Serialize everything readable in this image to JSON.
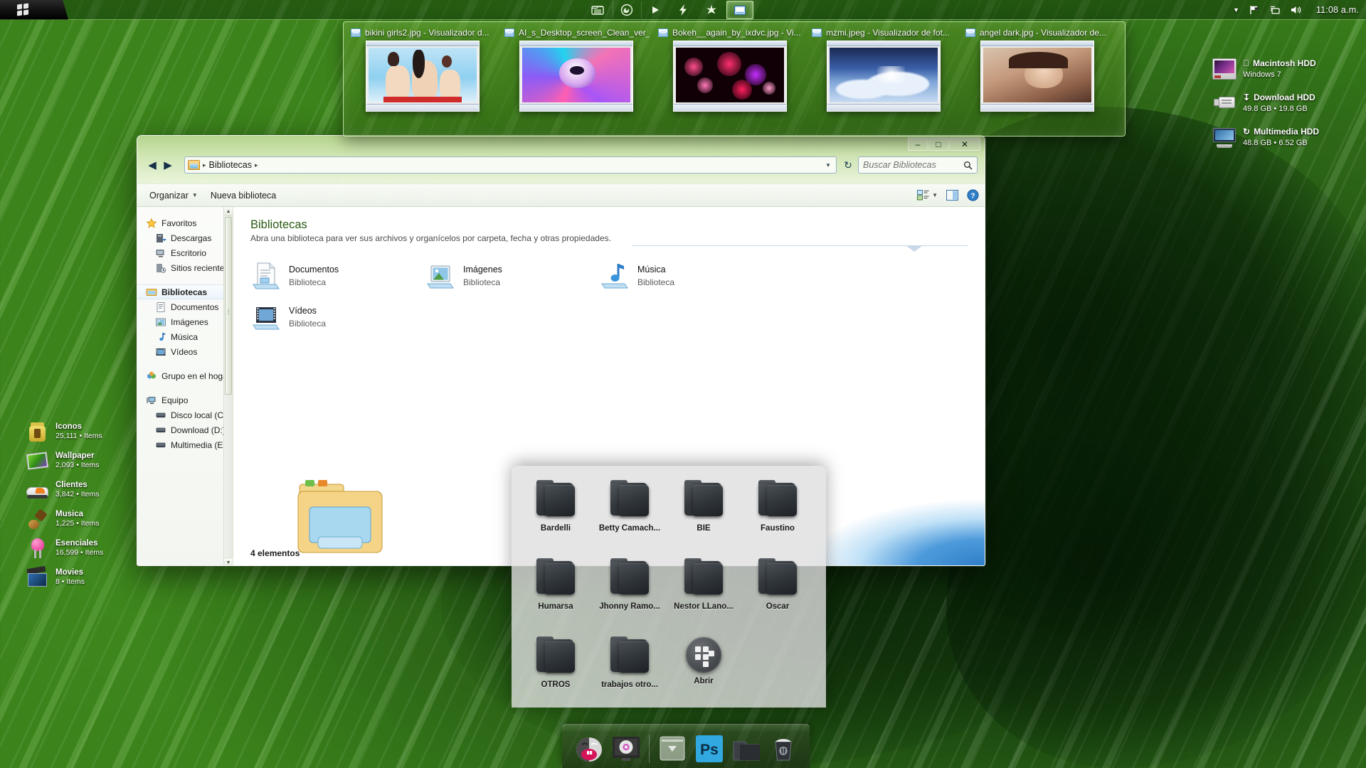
{
  "taskbar": {
    "start_label": "Start",
    "buttons": [
      {
        "name": "explorer-taskbar-button",
        "icon": "folder-icon",
        "active": false
      },
      {
        "name": "firefox-taskbar-button",
        "icon": "firefox-icon",
        "active": false
      },
      {
        "name": "media-player-taskbar-button",
        "icon": "play-icon",
        "active": false
      },
      {
        "name": "lightning-taskbar-button",
        "icon": "lightning-icon",
        "active": false
      },
      {
        "name": "sparkle-taskbar-button",
        "icon": "sparkle-icon",
        "active": false
      },
      {
        "name": "photo-viewer-taskbar-button",
        "icon": "photo-viewer-icon",
        "active": true
      }
    ],
    "tray": {
      "show_hidden_icons": "chevron-up-icon",
      "action_center": "flag-icon",
      "network": "network-icon",
      "volume": "speaker-icon",
      "clock": "11:08 a.m."
    }
  },
  "preview_strip": {
    "items": [
      {
        "title": "bikini girls2.jpg - Visualizador d...",
        "icon": "photo-viewer-icon",
        "art": "bikini"
      },
      {
        "title": "AI_s_Desktop_screen_Clean_ver_...",
        "icon": "photo-viewer-icon",
        "art": "ai"
      },
      {
        "title": "Bokeh__again_by_ixdvc.jpg - Vi...",
        "icon": "photo-viewer-icon",
        "art": "bokeh"
      },
      {
        "title": "mzmi.jpeg - Visualizador de fot...",
        "icon": "photo-viewer-icon",
        "art": "mzmi"
      },
      {
        "title": "angel dark.jpg - Visualizador de...",
        "icon": "photo-viewer-icon",
        "art": "angel"
      }
    ]
  },
  "desktop_left": {
    "items": [
      {
        "name": "Iconos",
        "count": "25,111 • Items",
        "icon": "jar-icon"
      },
      {
        "name": "Wallpaper",
        "count": "2,093 • Items",
        "icon": "picture-icon"
      },
      {
        "name": "Clientes",
        "count": "3,842 • Items",
        "icon": "shoe-icon"
      },
      {
        "name": "Musica",
        "count": "1,225 • Items",
        "icon": "guitar-icon"
      },
      {
        "name": "Esenciales",
        "count": "16,599 • Items",
        "icon": "led-icon"
      },
      {
        "name": "Movies",
        "count": "8 • Items",
        "icon": "clapperboard-icon"
      }
    ]
  },
  "desktop_right": {
    "drives": [
      {
        "glyph": "",
        "name": "Macintosh HDD",
        "sub": "Windows 7",
        "icon": "hard-drive-icon"
      },
      {
        "glyph": "↧",
        "name": "Download HDD",
        "sub": "49.8 GB • 19.8 GB",
        "icon": "usb-drive-icon"
      },
      {
        "glyph": "↻",
        "name": "Multimedia HDD",
        "sub": "48.8 GB • 6.52 GB",
        "icon": "external-drive-icon"
      }
    ]
  },
  "explorer": {
    "window_controls": {
      "minimize": "–",
      "maximize": "□",
      "close": "✕"
    },
    "nav": {
      "back": "◀",
      "forward": "▶"
    },
    "address": {
      "crumb": "Bibliotecas",
      "separator": "▸",
      "dropdown": "▾",
      "refresh": "↻"
    },
    "search": {
      "placeholder": "Buscar Bibliotecas",
      "value": "",
      "icon": "search-icon"
    },
    "toolbar": {
      "organize": "Organizar",
      "new_library": "Nueva biblioteca",
      "view_icon": "view-options-icon",
      "preview_pane_icon": "preview-pane-icon",
      "help_icon": "help-icon"
    },
    "sidebar": [
      {
        "label": "Favoritos",
        "icon": "star-icon",
        "level": 0,
        "selected": false
      },
      {
        "label": "Descargas",
        "icon": "downloads-icon",
        "level": 1,
        "selected": false
      },
      {
        "label": "Escritorio",
        "icon": "desktop-icon",
        "level": 1,
        "selected": false
      },
      {
        "label": "Sitios recientes",
        "icon": "recent-places-icon",
        "level": 1,
        "selected": false
      },
      {
        "label": "Bibliotecas",
        "icon": "libraries-icon",
        "level": 0,
        "selected": true
      },
      {
        "label": "Documentos",
        "icon": "documents-icon",
        "level": 1,
        "selected": false
      },
      {
        "label": "Imágenes",
        "icon": "pictures-icon",
        "level": 1,
        "selected": false
      },
      {
        "label": "Música",
        "icon": "music-icon",
        "level": 1,
        "selected": false
      },
      {
        "label": "Vídeos",
        "icon": "videos-icon",
        "level": 1,
        "selected": false
      },
      {
        "label": "Grupo en el hogar",
        "icon": "homegroup-icon",
        "level": 0,
        "selected": false
      },
      {
        "label": "Equipo",
        "icon": "computer-icon",
        "level": 0,
        "selected": false
      },
      {
        "label": "Disco local (C:)",
        "icon": "disk-icon",
        "level": 1,
        "selected": false
      },
      {
        "label": "Download (D:)",
        "icon": "disk-icon",
        "level": 1,
        "selected": false
      },
      {
        "label": "Multimedia (E:)",
        "icon": "disk-icon",
        "level": 1,
        "selected": false
      }
    ],
    "content": {
      "title": "Bibliotecas",
      "subtitle": "Abra una biblioteca para ver sus archivos y organícelos por carpeta, fecha y otras propiedades.",
      "libraries": [
        {
          "name": "Documentos",
          "kind": "Biblioteca",
          "icon": "documents-library-icon"
        },
        {
          "name": "Imágenes",
          "kind": "Biblioteca",
          "icon": "pictures-library-icon"
        },
        {
          "name": "Música",
          "kind": "Biblioteca",
          "icon": "music-library-icon"
        },
        {
          "name": "Vídeos",
          "kind": "Biblioteca",
          "icon": "videos-library-icon"
        }
      ]
    },
    "status": "4 elementos"
  },
  "stack_panel": {
    "items": [
      {
        "label": "Bardelli",
        "icon": "dark-folder-icon"
      },
      {
        "label": "Betty Camach...",
        "icon": "dark-folder-icon"
      },
      {
        "label": "BIE",
        "icon": "dark-folder-icon"
      },
      {
        "label": "Faustino",
        "icon": "dark-folder-icon"
      },
      {
        "label": "Humarsa",
        "icon": "dark-folder-icon"
      },
      {
        "label": "Jhonny Ramo...",
        "icon": "dark-folder-icon"
      },
      {
        "label": "Nestor LLano...",
        "icon": "dark-folder-icon"
      },
      {
        "label": "Oscar",
        "icon": "dark-folder-icon"
      },
      {
        "label": "OTROS",
        "icon": "dark-folder-icon"
      },
      {
        "label": "trabajos otro...",
        "icon": "dark-folder-icon"
      },
      {
        "label": "Abrir",
        "icon": "open-stack-icon"
      }
    ]
  },
  "dock": {
    "items": [
      {
        "name": "mascot-dock-icon",
        "label": "Mascota"
      },
      {
        "name": "system-preferences-dock-icon",
        "label": "Preferencias"
      },
      {
        "name": "downloads-stack-dock-icon",
        "label": "Descargas"
      },
      {
        "name": "photoshop-dock-icon",
        "label": "Ps"
      },
      {
        "name": "folder-dock-icon",
        "label": "Carpeta"
      },
      {
        "name": "trash-dock-icon",
        "label": "Papelera"
      }
    ],
    "photoshop_label": "Ps"
  },
  "colors": {
    "desktop_green": "#3d8416",
    "accent_blue": "#2f7ec8",
    "library_title": "#2a5b13"
  }
}
